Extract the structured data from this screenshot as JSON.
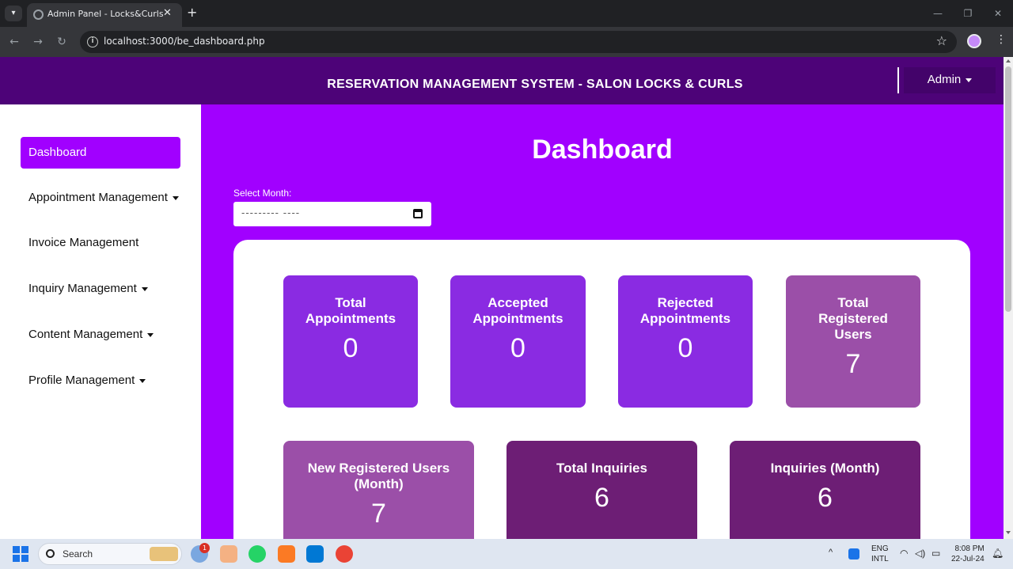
{
  "browser": {
    "tab_title": "Admin Panel - Locks&Curls",
    "new_tab": "+",
    "tab_close": "✕",
    "url": "localhost:3000/be_dashboard.php",
    "win_minimize": "—",
    "win_restore": "❐",
    "win_close": "✕",
    "back": "←",
    "forward": "→",
    "reload": "↻",
    "star": "☆",
    "kebab": "⋮"
  },
  "header": {
    "title": "RESERVATION MANAGEMENT SYSTEM - SALON LOCKS & CURLS",
    "admin_label": "Admin"
  },
  "sidebar": {
    "items": [
      {
        "label": "Dashboard",
        "active": true,
        "dropdown": false
      },
      {
        "label": "Appointment Management",
        "active": false,
        "dropdown": true
      },
      {
        "label": "Invoice Management",
        "active": false,
        "dropdown": false
      },
      {
        "label": "Inquiry Management",
        "active": false,
        "dropdown": true
      },
      {
        "label": "Content Management",
        "active": false,
        "dropdown": true
      },
      {
        "label": "Profile Management",
        "active": false,
        "dropdown": true
      }
    ]
  },
  "main": {
    "title": "Dashboard",
    "month_label": "Select Month:",
    "month_placeholder": "--------- ----"
  },
  "cards": [
    {
      "title": "Total Appointments",
      "value": "0"
    },
    {
      "title": "Accepted Appointments",
      "value": "0"
    },
    {
      "title": "Rejected Appointments",
      "value": "0"
    },
    {
      "title": "Total Registered Users",
      "value": "7"
    },
    {
      "title": "New Registered Users (Month)",
      "value": "7"
    },
    {
      "title": "Total Inquiries",
      "value": "6"
    },
    {
      "title": "Inquiries (Month)",
      "value": "6"
    }
  ],
  "taskbar": {
    "search_text": "Search",
    "badge": "1",
    "lang1": "ENG",
    "lang2": "INTL",
    "time": "8:08 PM",
    "date": "22-Jul-24"
  },
  "colors": {
    "header": "#4d0378",
    "page_bg": "#a100ff",
    "card_purple": "#8a2be2",
    "card_mauve": "#9b4fa8",
    "card_plum": "#6d1e75"
  }
}
